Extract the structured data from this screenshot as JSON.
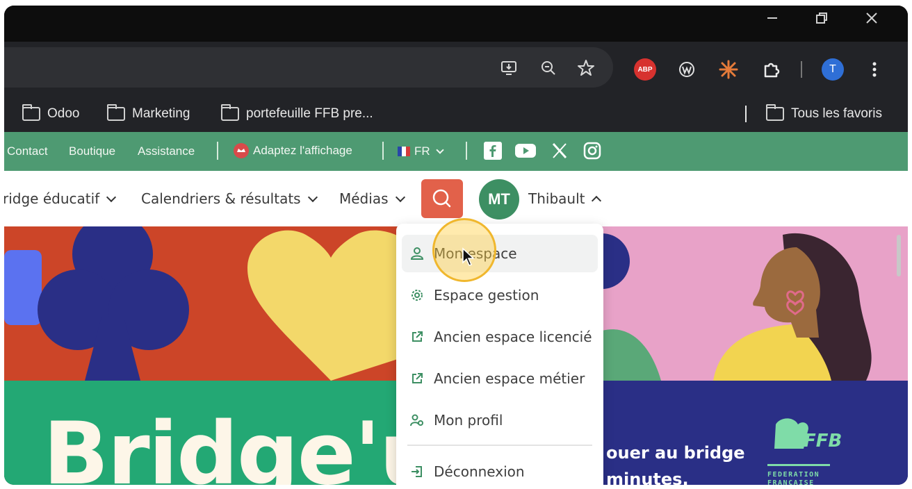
{
  "window": {
    "minimize_icon": "minimize-icon",
    "restore_icon": "restore-icon",
    "close_icon": "close-icon"
  },
  "toolbar": {
    "icons": [
      "install-app-icon",
      "zoom-icon",
      "bookmark-star-icon",
      "adblock-icon",
      "extension-w-icon",
      "extension-star-icon",
      "extensions-puzzle-icon",
      "profile-avatar",
      "menu-kebab-icon"
    ],
    "adblock_label": "ABP",
    "profile_initial": "T"
  },
  "bookmarks": {
    "items": [
      "Odoo",
      "Marketing",
      "portefeuille FFB pre..."
    ],
    "all_label": "Tous les favoris"
  },
  "topbar": {
    "links": [
      "Contact",
      "Boutique",
      "Assistance"
    ],
    "display_label": "Adaptez l'affichage",
    "lang": "FR",
    "social_icons": [
      "facebook-icon",
      "youtube-icon",
      "x-icon",
      "instagram-icon"
    ]
  },
  "nav": {
    "items": [
      "ridge éducatif",
      "Calendriers & résultats",
      "Médias"
    ],
    "user_initials": "MT",
    "user_name": "Thibault"
  },
  "menu": {
    "items": [
      {
        "label": "Mon espace",
        "icon": "user-icon"
      },
      {
        "label": "Espace gestion",
        "icon": "gear-icon"
      },
      {
        "label": "Ancien espace licencié",
        "icon": "external-link-icon"
      },
      {
        "label": "Ancien espace métier",
        "icon": "external-link-icon"
      },
      {
        "label": "Mon profil",
        "icon": "user-settings-icon"
      }
    ],
    "logout": "Déconnexion"
  },
  "hero": {
    "title": "Bridge'up",
    "side_text_1": "ouer au bridge",
    "side_text_2": "minutes.",
    "org_line_1": "FEDERATION",
    "org_line_2": "FRANÇAISE",
    "org_logo_text": "FFB"
  },
  "colors": {
    "site_green": "#4e9a72",
    "search_red": "#e2614a",
    "avatar_green": "#3d8f63",
    "hero_red": "#cc4528",
    "hero_yellow": "#f3d86a",
    "hero_navy": "#2a2f86",
    "hero_pink": "#e8a2c8",
    "hero_teal": "#23a874"
  }
}
